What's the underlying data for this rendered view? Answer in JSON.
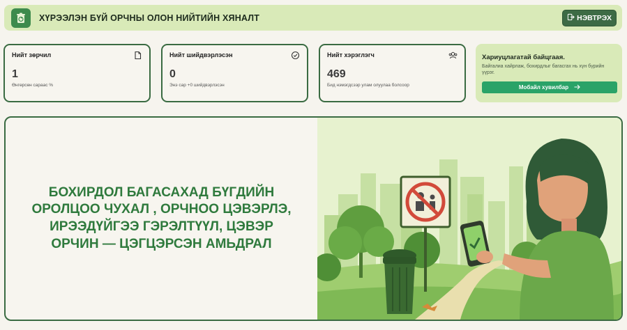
{
  "header": {
    "title": "ХҮРЭЭЛЭН БҮЙ ОРЧНЫ ОЛОН НИЙТИЙН ХЯНАЛТ",
    "logout_label": "НЭВТРЭХ",
    "logo_icon": "recycle-bin-icon",
    "logout_icon": "logout-icon"
  },
  "stats": [
    {
      "label": "Нийт зөрчил",
      "value": "1",
      "sub": "Өнгөрсөн сараас %",
      "icon": "document-icon"
    },
    {
      "label": "Нийт шийдвэрлэсэн",
      "value": "0",
      "sub": "Энэ сар +0 шийдвэрлэсэн",
      "icon": "check-circle-icon"
    },
    {
      "label": "Нийт хэрэглэгч",
      "value": "469",
      "sub": "Бид нэмэгдсээр улам олуулаа болсоор",
      "icon": "users-icon"
    }
  ],
  "support": {
    "title": "Хариуцлагатай байцгаая.",
    "text": "Байгалиа хайрлаж, бохирдлыг багасгах нь хүн бүрийн үүрэг.",
    "button_label": "Мобайл хувилбар",
    "button_icon": "arrow-right-icon"
  },
  "hero": {
    "text": "БОХИРДОЛ БАГАСАХАД БҮГДИЙН ОРОЛЦОО ЧУХАЛ , ОРЧНОО ЦЭВЭРЛЭ, ИРЭЭДҮЙГЭЭ ГЭРЭЛТҮҮЛ, ЦЭВЭР ОРЧИН — ЦЭГЦЭРСЭН АМЬДРАЛ"
  },
  "colors": {
    "accent": "#3a6b42",
    "header_bg": "#d9eab8",
    "hero_text": "#2f7a3d",
    "button_green": "#2aa368"
  }
}
